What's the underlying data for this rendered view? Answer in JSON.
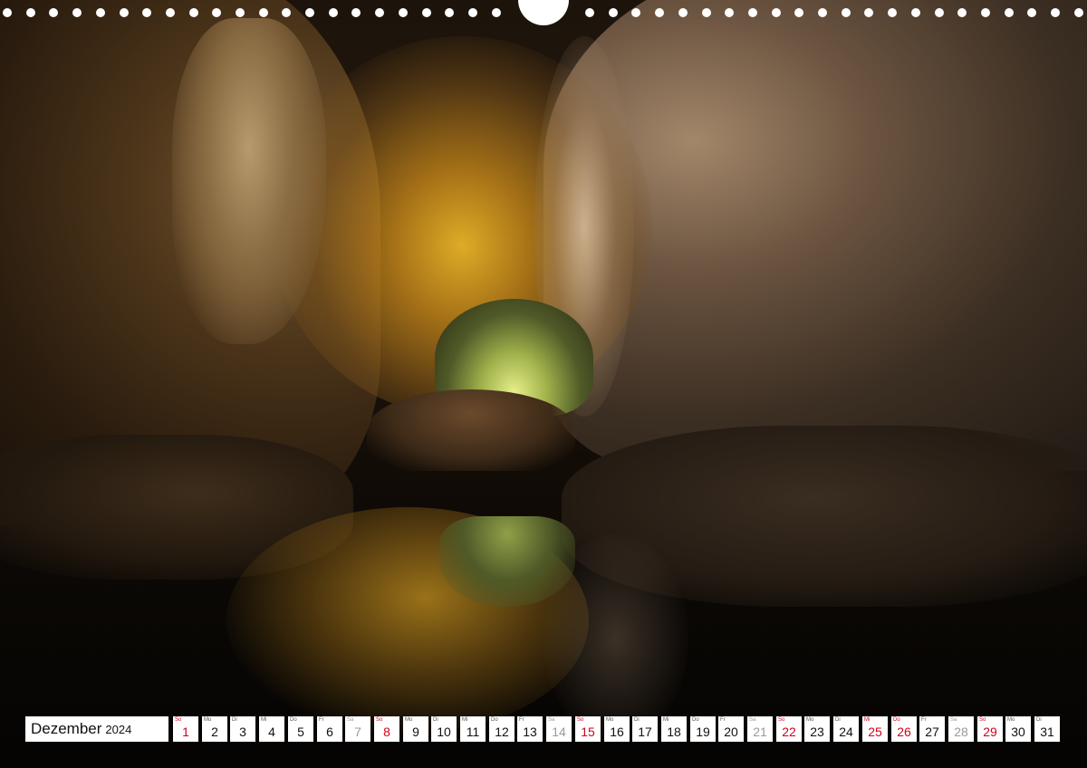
{
  "photo": {
    "subject": "cave",
    "icon": "cave-photo"
  },
  "calendar": {
    "month": "Dezember",
    "year": "2024",
    "colors": {
      "sunday": "#d0021b",
      "holiday": "#d0021b",
      "saturday": "#9a9a9a",
      "weekday": "#111111",
      "cell_background": "#ffffff"
    },
    "days": [
      {
        "weekday": "So",
        "day": "1",
        "type": "sun"
      },
      {
        "weekday": "Mo",
        "day": "2",
        "type": "weekday"
      },
      {
        "weekday": "Di",
        "day": "3",
        "type": "weekday"
      },
      {
        "weekday": "Mi",
        "day": "4",
        "type": "weekday"
      },
      {
        "weekday": "Do",
        "day": "5",
        "type": "weekday"
      },
      {
        "weekday": "Fr",
        "day": "6",
        "type": "weekday"
      },
      {
        "weekday": "Sa",
        "day": "7",
        "type": "sat"
      },
      {
        "weekday": "So",
        "day": "8",
        "type": "sun"
      },
      {
        "weekday": "Mo",
        "day": "9",
        "type": "weekday"
      },
      {
        "weekday": "Di",
        "day": "10",
        "type": "weekday"
      },
      {
        "weekday": "Mi",
        "day": "11",
        "type": "weekday"
      },
      {
        "weekday": "Do",
        "day": "12",
        "type": "weekday"
      },
      {
        "weekday": "Fr",
        "day": "13",
        "type": "weekday"
      },
      {
        "weekday": "Sa",
        "day": "14",
        "type": "sat"
      },
      {
        "weekday": "So",
        "day": "15",
        "type": "sun"
      },
      {
        "weekday": "Mo",
        "day": "16",
        "type": "weekday"
      },
      {
        "weekday": "Di",
        "day": "17",
        "type": "weekday"
      },
      {
        "weekday": "Mi",
        "day": "18",
        "type": "weekday"
      },
      {
        "weekday": "Do",
        "day": "19",
        "type": "weekday"
      },
      {
        "weekday": "Fr",
        "day": "20",
        "type": "weekday"
      },
      {
        "weekday": "Sa",
        "day": "21",
        "type": "sat"
      },
      {
        "weekday": "So",
        "day": "22",
        "type": "sun"
      },
      {
        "weekday": "Mo",
        "day": "23",
        "type": "weekday"
      },
      {
        "weekday": "Di",
        "day": "24",
        "type": "weekday"
      },
      {
        "weekday": "Mi",
        "day": "25",
        "type": "holiday"
      },
      {
        "weekday": "Do",
        "day": "26",
        "type": "holiday"
      },
      {
        "weekday": "Fr",
        "day": "27",
        "type": "weekday"
      },
      {
        "weekday": "Sa",
        "day": "28",
        "type": "sat"
      },
      {
        "weekday": "So",
        "day": "29",
        "type": "sun"
      },
      {
        "weekday": "Mo",
        "day": "30",
        "type": "weekday"
      },
      {
        "weekday": "Di",
        "day": "31",
        "type": "weekday"
      }
    ]
  }
}
